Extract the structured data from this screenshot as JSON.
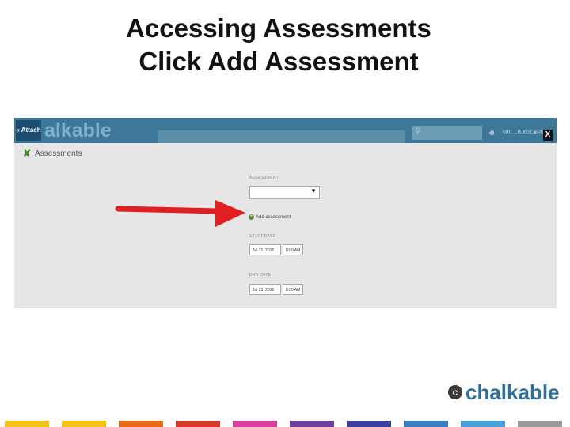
{
  "slide": {
    "title_line1": "Accessing Assessments",
    "title_line2": "Click Add Assessment"
  },
  "app": {
    "attach_label": "« Attach",
    "logo_text": "alkable",
    "user_label": "MR. LINKSCHPEM",
    "close_label": "X",
    "page_title": "Assessments",
    "assessment_label": "ASSESSMENT",
    "select_value": "",
    "add_assessment_label": "Add assessment",
    "start_date_label": "START DATE",
    "start_date_value": "Jul 21, 2015",
    "start_time_value": "8:00 AM",
    "end_date_label": "END DATE",
    "end_date_value": "Jul 23, 2015",
    "end_time_value": "8:00 AM",
    "colors": {
      "topbar": "#3d7898",
      "arrow": "#e02020"
    }
  },
  "footer": {
    "brand": "chalkable",
    "stripe_colors": [
      "#f2c21b",
      "#f2c21b",
      "#e86a1c",
      "#d63a2a",
      "#d6409c",
      "#6b3f9e",
      "#3d3f9e",
      "#3a7fc2",
      "#4aa0d8",
      "#9a9a9a"
    ]
  }
}
